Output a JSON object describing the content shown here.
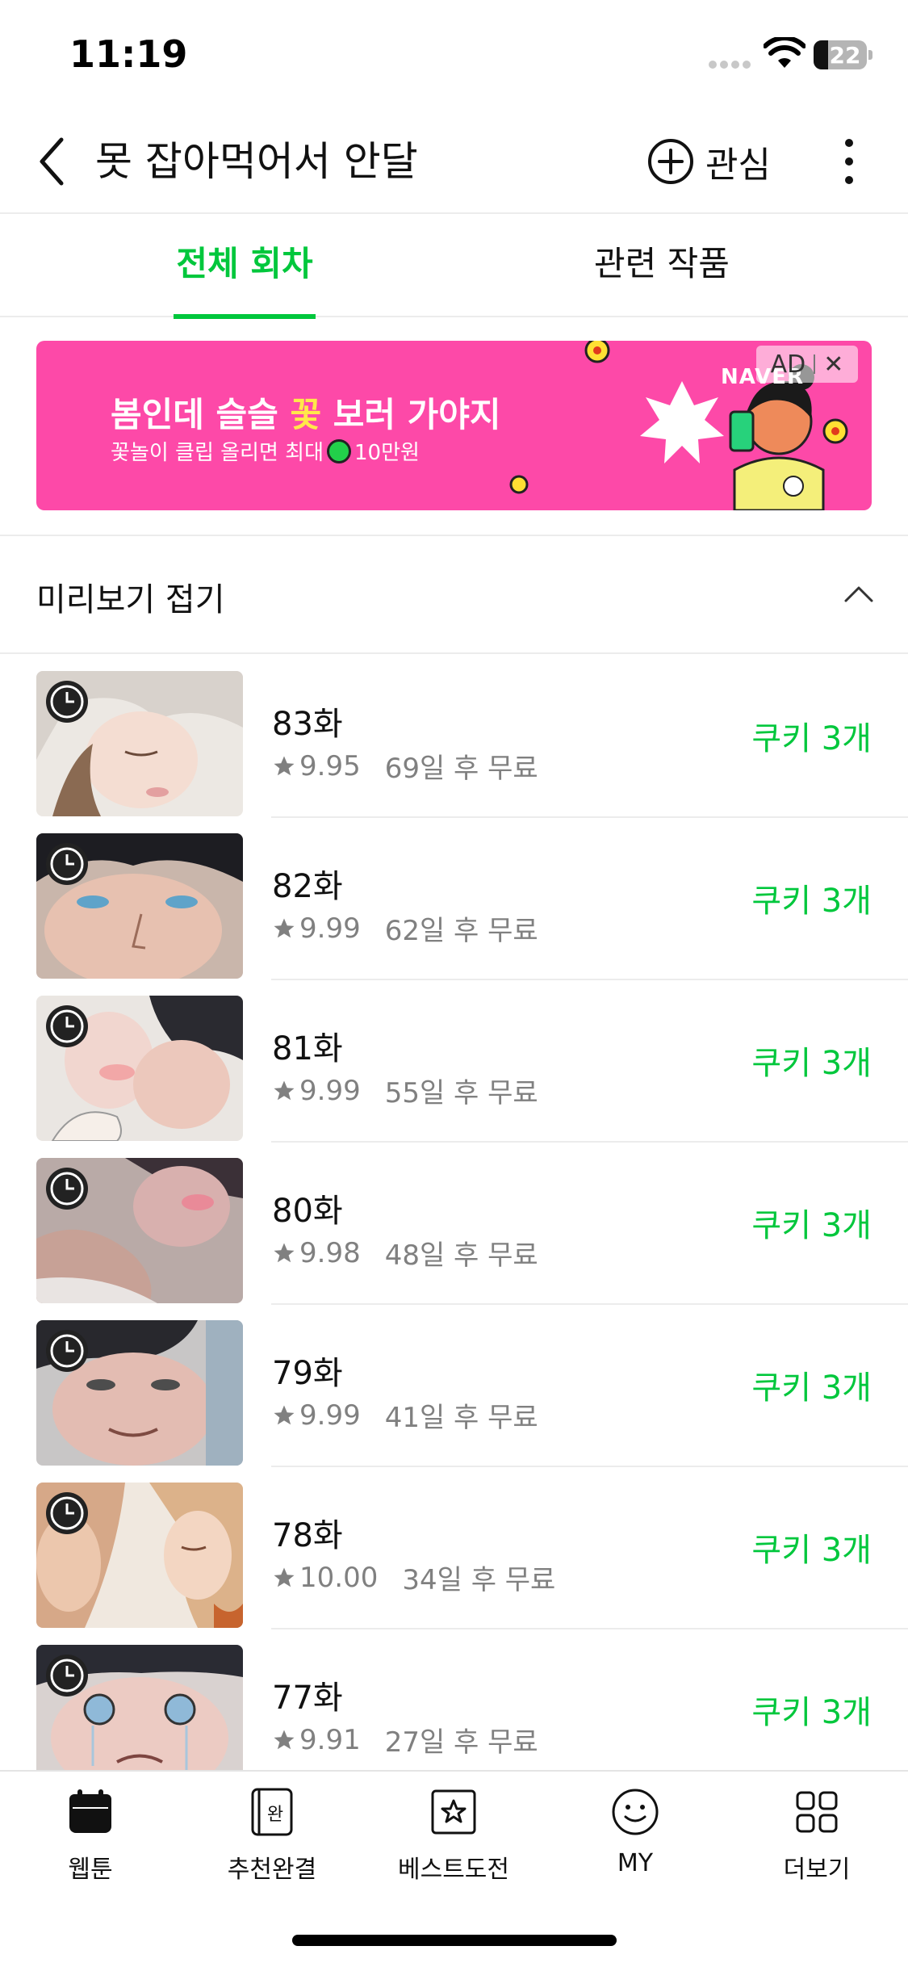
{
  "status_bar": {
    "time": "11:19",
    "battery": "22"
  },
  "header": {
    "title": "못 잡아먹어서 안달",
    "favorite_label": "관심"
  },
  "tabs": [
    {
      "label": "전체 회차",
      "active": true
    },
    {
      "label": "관련 작품",
      "active": false
    }
  ],
  "ad": {
    "headline_part1": "봄인데 슬슬 ",
    "headline_highlight": "꽃",
    "headline_part2": " 보러 가야지",
    "sub_text_1": "꽃놀이 클립 올리면 최대",
    "sub_text_2": "10만원",
    "brand": "NAVER",
    "badge_label": "AD",
    "close_glyph": "✕",
    "bg_color": "#fd49a8"
  },
  "preview_fold": {
    "label": "미리보기 접기"
  },
  "episodes": [
    {
      "title": "83화",
      "rating": "9.95",
      "free_in": "69일 후 무료",
      "price": "쿠키 3개"
    },
    {
      "title": "82화",
      "rating": "9.99",
      "free_in": "62일 후 무료",
      "price": "쿠키 3개"
    },
    {
      "title": "81화",
      "rating": "9.99",
      "free_in": "55일 후 무료",
      "price": "쿠키 3개"
    },
    {
      "title": "80화",
      "rating": "9.98",
      "free_in": "48일 후 무료",
      "price": "쿠키 3개"
    },
    {
      "title": "79화",
      "rating": "9.99",
      "free_in": "41일 후 무료",
      "price": "쿠키 3개"
    },
    {
      "title": "78화",
      "rating": "10.00",
      "free_in": "34일 후 무료",
      "price": "쿠키 3개"
    },
    {
      "title": "77화",
      "rating": "9.91",
      "free_in": "27일 후 무료",
      "price": "쿠키 3개"
    }
  ],
  "bottom_nav": [
    {
      "label": "웹툰",
      "icon": "calendar-icon",
      "active": true
    },
    {
      "label": "추천완결",
      "icon": "book-complete-icon",
      "glyph": "완"
    },
    {
      "label": "베스트도전",
      "icon": "star-box-icon"
    },
    {
      "label": "MY",
      "icon": "smiley-icon"
    },
    {
      "label": "더보기",
      "icon": "grid-icon"
    }
  ],
  "colors": {
    "accent": "#00c73c",
    "muted": "#808080"
  }
}
